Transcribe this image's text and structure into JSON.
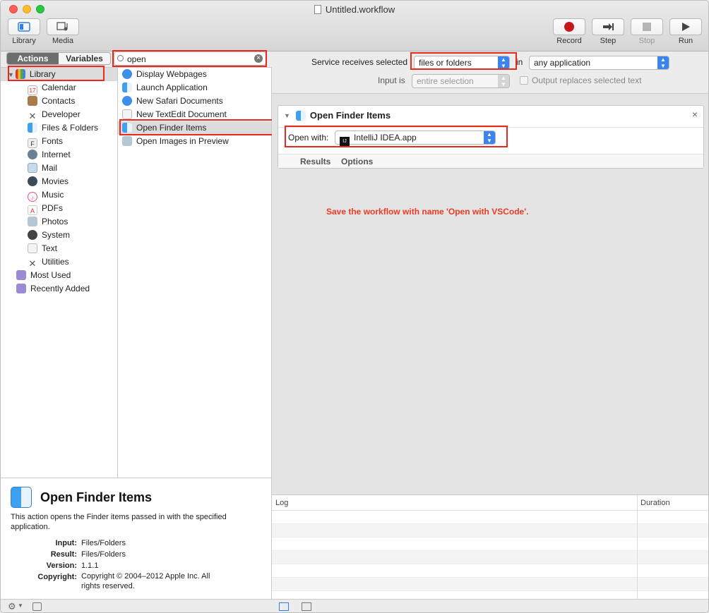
{
  "window": {
    "title": "Untitled.workflow"
  },
  "toolbar": {
    "library_label": "Library",
    "media_label": "Media",
    "record_label": "Record",
    "step_label": "Step",
    "stop_label": "Stop",
    "run_label": "Run"
  },
  "left_tabs": {
    "actions": "Actions",
    "variables": "Variables"
  },
  "search": {
    "value": "open"
  },
  "library": {
    "root": "Library",
    "items": [
      "Calendar",
      "Contacts",
      "Developer",
      "Files & Folders",
      "Fonts",
      "Internet",
      "Mail",
      "Movies",
      "Music",
      "PDFs",
      "Photos",
      "System",
      "Text",
      "Utilities"
    ],
    "folders": [
      "Most Used",
      "Recently Added"
    ]
  },
  "actions_list": [
    "Display Webpages",
    "Launch Application",
    "New Safari Documents",
    "New TextEdit Document",
    "Open Finder Items",
    "Open Images in Preview"
  ],
  "description": {
    "title": "Open Finder Items",
    "text": "This action opens the Finder items passed in with the specified application.",
    "input_key": "Input:",
    "input_val": "Files/Folders",
    "result_key": "Result:",
    "result_val": "Files/Folders",
    "version_key": "Version:",
    "version_val": "1.1.1",
    "copyright_key": "Copyright:",
    "copyright_val": "Copyright © 2004–2012 Apple Inc.  All rights reserved."
  },
  "service": {
    "receives_label": "Service receives selected",
    "receives_value": "files or folders",
    "in_label": "in",
    "app_value": "any application",
    "input_is_label": "Input is",
    "input_is_value": "entire selection",
    "replace_label": "Output replaces selected text"
  },
  "card": {
    "title": "Open Finder Items",
    "open_with_label": "Open with:",
    "open_with_value": "IntelliJ IDEA.app",
    "app_badge": "IJ",
    "results_tab": "Results",
    "options_tab": "Options",
    "close": "×"
  },
  "annotation": "Save the workflow with name 'Open with VSCode'.",
  "log": {
    "log_col": "Log",
    "duration_col": "Duration"
  },
  "colors": {
    "highlight_box": "#e8291c",
    "annotation": "#ee3a24",
    "popup_accent": "#3a84f2"
  }
}
